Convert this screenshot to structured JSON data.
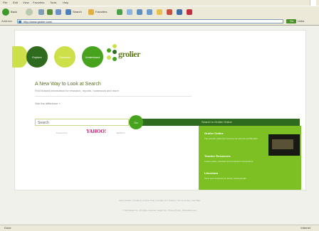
{
  "browser": {
    "menus": [
      "File",
      "Edit",
      "View",
      "Favorites",
      "Tools",
      "Help"
    ],
    "toolbar": {
      "back": "Back",
      "search": "Search",
      "favorites": "Favorites"
    },
    "address_label": "Address",
    "address": "http://www.grolier.com/",
    "go": "Go",
    "links": "Links",
    "status": "Done",
    "zone": "Internet"
  },
  "page": {
    "circles": [
      "Explore",
      "Discover",
      "Understand"
    ],
    "logo": "grolier",
    "headline": "A New Way to Look at Search",
    "subline": "Find trusted information for research, reports, homework and more",
    "difference_link": "See the difference »",
    "search_value": "Search",
    "search_button": "Go",
    "bar_text": "Search in Grolier Online",
    "powered_by": "Powered by",
    "yahoo": "YAHOO!",
    "search_label": "SEARCH",
    "panel": {
      "section1_title": "Grolier Online",
      "section1_text": "The premier reference resource for schools and libraries",
      "section2_title": "Teacher Resources",
      "section2_text": "Lesson plans, activities and curriculum connections",
      "section3_title": "Librarians",
      "section3_text": "Tools and resources for library professionals"
    },
    "footer_links": "About Grolier | Products | Online Help | Contact Us | Privacy | Terms of Use | Site Map",
    "footer_copy": "© Scholastic Inc. All rights reserved. Legal Info. Privacy Policy. Scholastic.com"
  },
  "colors": {
    "dark_green": "#2f6b1e",
    "lime": "#cde04a",
    "mid_green": "#47a31e",
    "panel_green": "#7dc024",
    "yahoo_magenta": "#c0166b"
  }
}
